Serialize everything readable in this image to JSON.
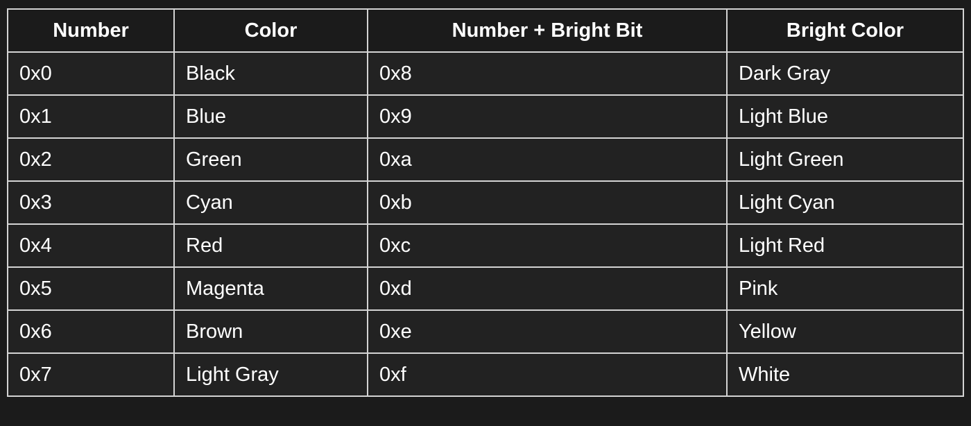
{
  "table": {
    "headers": [
      "Number",
      "Color",
      "Number + Bright Bit",
      "Bright Color"
    ],
    "rows": [
      [
        "0x0",
        "Black",
        "0x8",
        "Dark Gray"
      ],
      [
        "0x1",
        "Blue",
        "0x9",
        "Light Blue"
      ],
      [
        "0x2",
        "Green",
        "0xa",
        "Light Green"
      ],
      [
        "0x3",
        "Cyan",
        "0xb",
        "Light Cyan"
      ],
      [
        "0x4",
        "Red",
        "0xc",
        "Light Red"
      ],
      [
        "0x5",
        "Magenta",
        "0xd",
        "Pink"
      ],
      [
        "0x6",
        "Brown",
        "0xe",
        "Yellow"
      ],
      [
        "0x7",
        "Light Gray",
        "0xf",
        "White"
      ]
    ]
  },
  "colors": {
    "page_background": "#1b1b1b",
    "header_background": "#1b1b1b",
    "cell_background": "#222222",
    "border": "#d4d4d4",
    "text": "#ffffff"
  }
}
